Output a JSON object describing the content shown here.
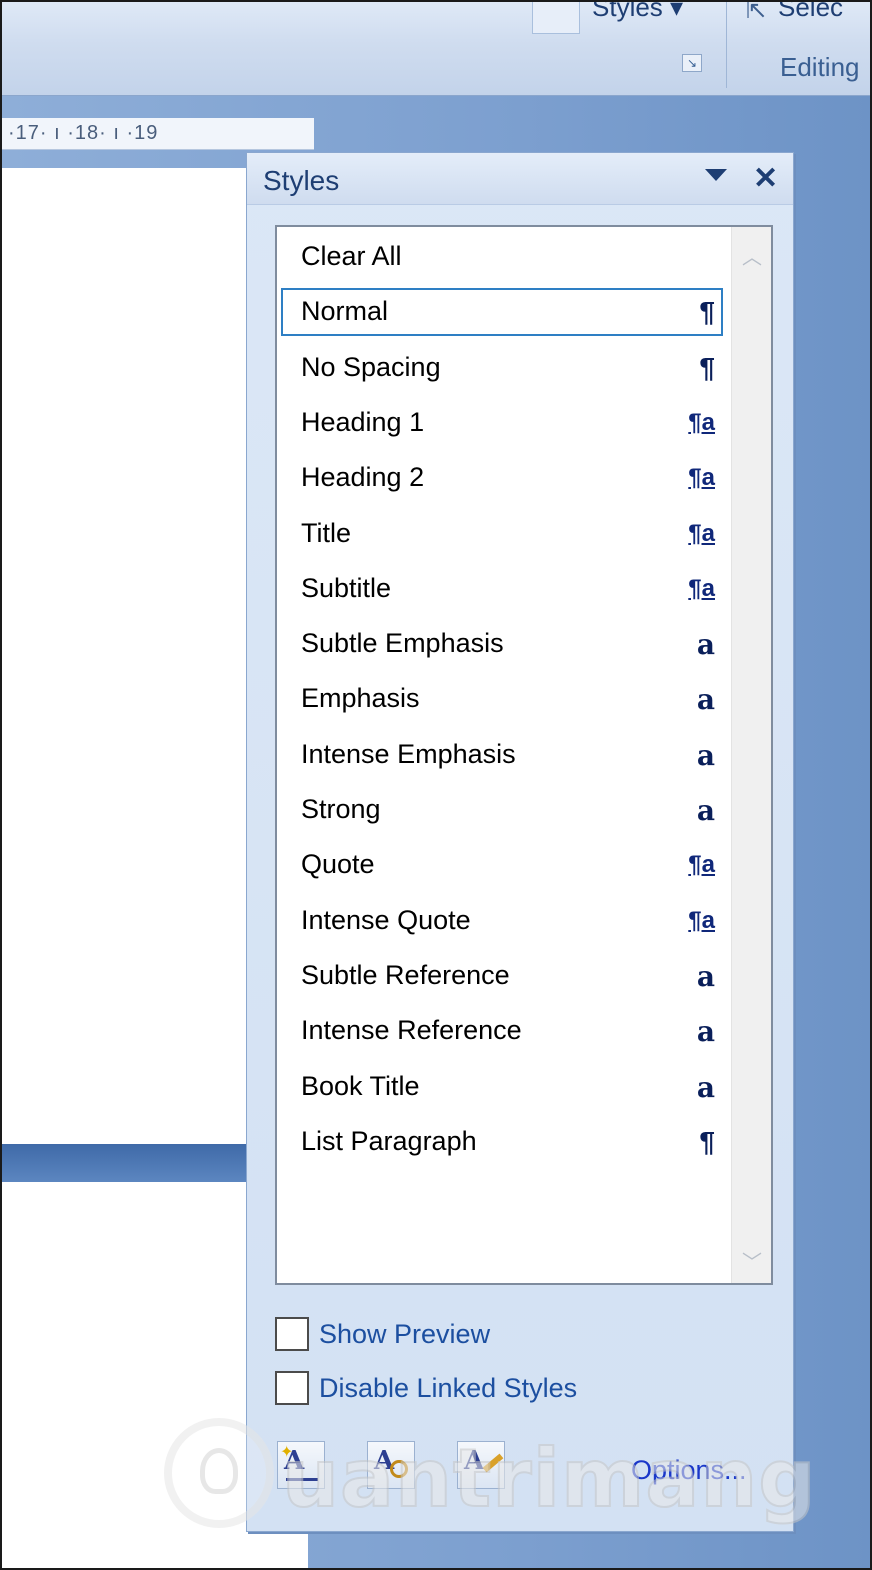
{
  "ribbon": {
    "styles_button": "Styles ▾",
    "select_label": "Selec",
    "editing_group": "Editing",
    "launcher_icon": "dialog-launcher-icon",
    "select_icon": "select-arrow-icon"
  },
  "ruler": {
    "text": "·17· ı ·18· ı ·19"
  },
  "pane": {
    "title": "Styles",
    "menu_icon": "dropdown-arrow-icon",
    "close_glyph": "✕",
    "styles": [
      {
        "name": "Clear All",
        "icon": "",
        "type": "none",
        "selected": false
      },
      {
        "name": "Normal",
        "icon": "¶",
        "type": "paragraph",
        "selected": true
      },
      {
        "name": "No Spacing",
        "icon": "¶",
        "type": "paragraph",
        "selected": false
      },
      {
        "name": "Heading 1",
        "icon": "¶a",
        "type": "linked",
        "selected": false
      },
      {
        "name": "Heading 2",
        "icon": "¶a",
        "type": "linked",
        "selected": false
      },
      {
        "name": "Title",
        "icon": "¶a",
        "type": "linked",
        "selected": false
      },
      {
        "name": "Subtitle",
        "icon": "¶a",
        "type": "linked",
        "selected": false
      },
      {
        "name": "Subtle Emphasis",
        "icon": "a",
        "type": "character",
        "selected": false
      },
      {
        "name": "Emphasis",
        "icon": "a",
        "type": "character",
        "selected": false
      },
      {
        "name": "Intense Emphasis",
        "icon": "a",
        "type": "character",
        "selected": false
      },
      {
        "name": "Strong",
        "icon": "a",
        "type": "character",
        "selected": false
      },
      {
        "name": "Quote",
        "icon": "¶a",
        "type": "linked",
        "selected": false
      },
      {
        "name": "Intense Quote",
        "icon": "¶a",
        "type": "linked",
        "selected": false
      },
      {
        "name": "Subtle Reference",
        "icon": "a",
        "type": "character",
        "selected": false
      },
      {
        "name": "Intense Reference",
        "icon": "a",
        "type": "character",
        "selected": false
      },
      {
        "name": "Book Title",
        "icon": "a",
        "type": "character",
        "selected": false
      },
      {
        "name": "List Paragraph",
        "icon": "¶",
        "type": "paragraph",
        "selected": false
      }
    ],
    "show_preview": {
      "label": "Show Preview",
      "checked": false
    },
    "disable_linked": {
      "label": "Disable Linked Styles",
      "checked": false
    },
    "buttons": [
      {
        "name": "new-style-button",
        "glyph": "A",
        "icon": "new-style-icon"
      },
      {
        "name": "style-inspector-button",
        "glyph": "A",
        "icon": "style-inspector-icon"
      },
      {
        "name": "manage-styles-button",
        "glyph": "A",
        "icon": "manage-styles-icon"
      }
    ],
    "options_link": "Options..."
  },
  "watermark": {
    "text": "uantrimang",
    "icon": "lightbulb-logo-icon"
  }
}
